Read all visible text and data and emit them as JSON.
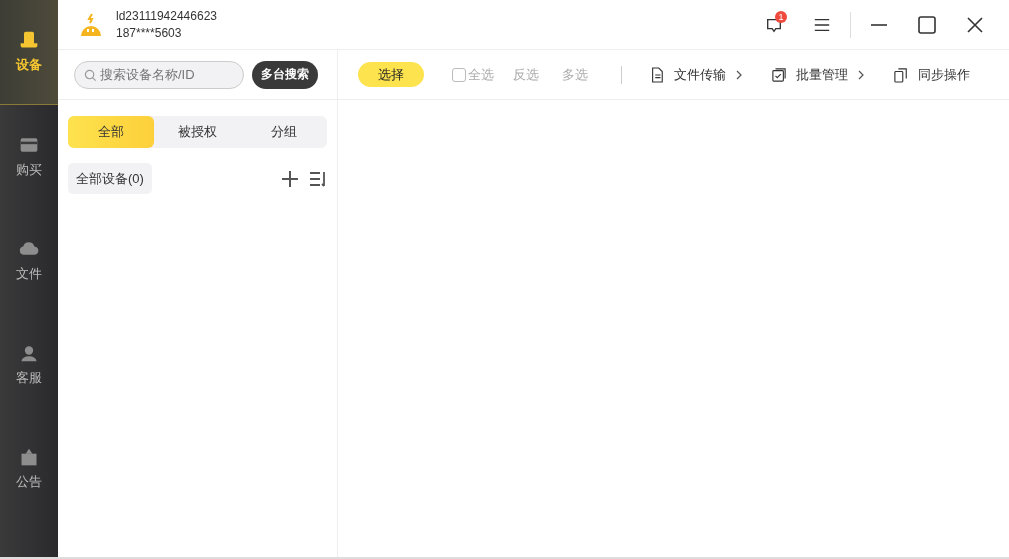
{
  "sidebar": {
    "items": [
      {
        "label": "设备",
        "selected": true
      },
      {
        "label": "购买",
        "selected": false
      },
      {
        "label": "文件",
        "selected": false
      },
      {
        "label": "客服",
        "selected": false
      },
      {
        "label": "公告",
        "selected": false
      }
    ]
  },
  "account": {
    "id": "ld23111942446623",
    "phone": "187****5603"
  },
  "header": {
    "message_badge": "1"
  },
  "search": {
    "placeholder": "搜索设备名称/ID",
    "button": "多台搜索"
  },
  "toolbar": {
    "select_button": "选择",
    "select_all": {
      "label": "全选",
      "checked": false,
      "disabled": true
    },
    "invert": {
      "label": "反选",
      "disabled": true
    },
    "multi": {
      "label": "多选",
      "disabled": true
    },
    "actions": [
      {
        "label": "文件传输",
        "chevron": true
      },
      {
        "label": "批量管理",
        "chevron": true
      },
      {
        "label": "同步操作",
        "chevron": false
      }
    ]
  },
  "tabs": [
    {
      "label": "全部",
      "selected": true
    },
    {
      "label": "被授权",
      "selected": false
    },
    {
      "label": "分组",
      "selected": false
    }
  ],
  "group": {
    "label": "全部设备(0)"
  }
}
